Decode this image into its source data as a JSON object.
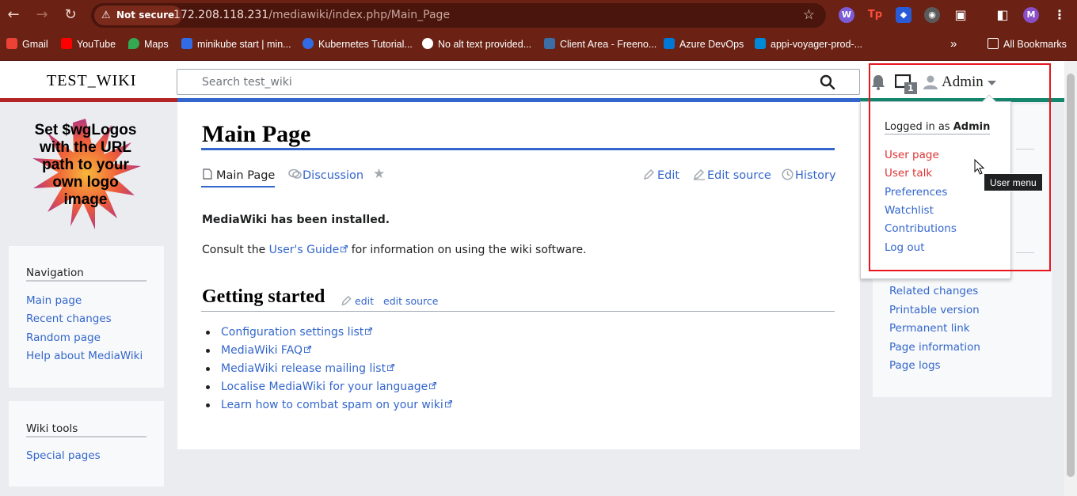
{
  "browser": {
    "security_label": "Not secure",
    "url_host": "172.208.118.231",
    "url_path": "/mediawiki/index.php/Main_Page",
    "avatar_initial": "M",
    "tp_ext_label": "Tp",
    "bookmarks": [
      {
        "label": "Gmail",
        "icon": "gmail-icon",
        "color": "#ea4335"
      },
      {
        "label": "YouTube",
        "icon": "youtube-icon",
        "color": "#ff0000"
      },
      {
        "label": "Maps",
        "icon": "maps-icon",
        "color": "#34a853"
      },
      {
        "label": "minikube start | min...",
        "icon": "minikube-icon",
        "color": "#326ce5"
      },
      {
        "label": "Kubernetes Tutorial...",
        "icon": "kubernetes-icon",
        "color": "#326ce5"
      },
      {
        "label": "No alt text provided...",
        "icon": "globe-icon",
        "color": "#ffffff"
      },
      {
        "label": "Client Area - Freeno...",
        "icon": "freenom-icon",
        "color": "#3a6ea5"
      },
      {
        "label": "Azure DevOps",
        "icon": "azure-devops-icon",
        "color": "#0078d4"
      },
      {
        "label": "appi-voyager-prod-...",
        "icon": "azure-icon",
        "color": "#0089d6"
      }
    ],
    "all_bookmarks": "All Bookmarks"
  },
  "header": {
    "site_title": "TEST_WIKI",
    "search_placeholder": "Search test_wiki",
    "notice_count": "1",
    "username": "Admin"
  },
  "sidebar": {
    "logo_text": "Set $wgLogos with the URL path to your own logo image",
    "navigation": {
      "heading": "Navigation",
      "items": [
        "Main page",
        "Recent changes",
        "Random page",
        "Help about MediaWiki"
      ]
    },
    "wiki_tools": {
      "heading": "Wiki tools",
      "items": [
        "Special pages"
      ]
    }
  },
  "page": {
    "title": "Main Page",
    "tabs": {
      "main_page": "Main Page",
      "discussion": "Discussion",
      "edit": "Edit",
      "edit_source": "Edit source",
      "history": "History"
    },
    "installed": "MediaWiki has been installed.",
    "consult_prefix": "Consult the ",
    "users_guide": "User's Guide",
    "consult_suffix": " for information on using the wiki software.",
    "section_title": "Getting started",
    "section_edit": "edit",
    "section_edit_source": "edit source",
    "links": [
      "Configuration settings list",
      "MediaWiki FAQ",
      "MediaWiki release mailing list",
      "Localise MediaWiki for your language",
      "Learn how to combat spam on your wiki"
    ]
  },
  "page_tools": {
    "items": [
      "Related changes",
      "Printable version",
      "Permanent link",
      "Page information",
      "Page logs"
    ]
  },
  "user_dropdown": {
    "logged_in_prefix": "Logged in as ",
    "logged_in_user": "Admin",
    "items": [
      "User page",
      "User talk",
      "Preferences",
      "Watchlist",
      "Contributions",
      "Log out"
    ]
  },
  "tooltip": "User menu",
  "colors": {
    "browser_frame": "#6b2214",
    "link": "#3366cc",
    "red_link": "#dd3333",
    "highlight": "#e8141e"
  }
}
